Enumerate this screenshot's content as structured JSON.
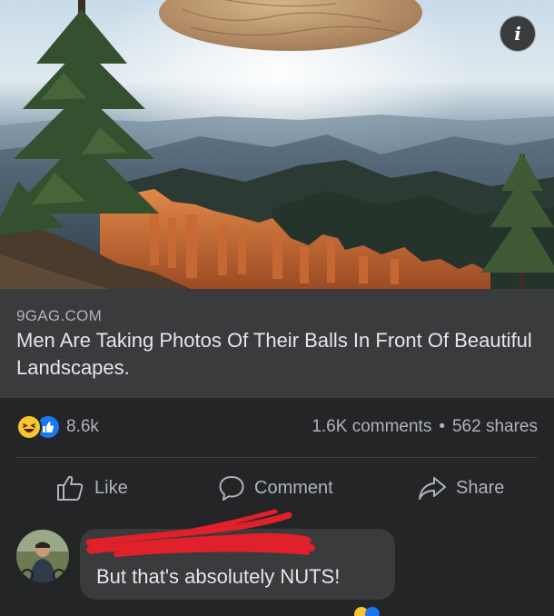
{
  "hero": {
    "info_icon": "info-icon",
    "info_glyph": "i"
  },
  "link_preview": {
    "domain": "9GAG.COM",
    "title": "Men Are Taking Photos Of Their Balls In Front Of Beautiful Landscapes."
  },
  "reactions": {
    "icons": [
      "haha-reaction-icon",
      "like-reaction-icon"
    ],
    "count": "8.6k",
    "comments": "1.6K comments",
    "separator": "•",
    "shares": "562 shares"
  },
  "actions": {
    "like": "Like",
    "comment": "Comment",
    "share": "Share"
  },
  "comment": {
    "author": "",
    "text": "But that's absolutely NUTS!"
  },
  "colors": {
    "background": "#242526",
    "card": "#3a3b3c",
    "secondary_text": "#b0b3b8",
    "primary_text": "#e4e6eb",
    "like_blue": "#1877f2",
    "haha_yellow": "#f7c531",
    "redaction_red": "#e0202a"
  }
}
